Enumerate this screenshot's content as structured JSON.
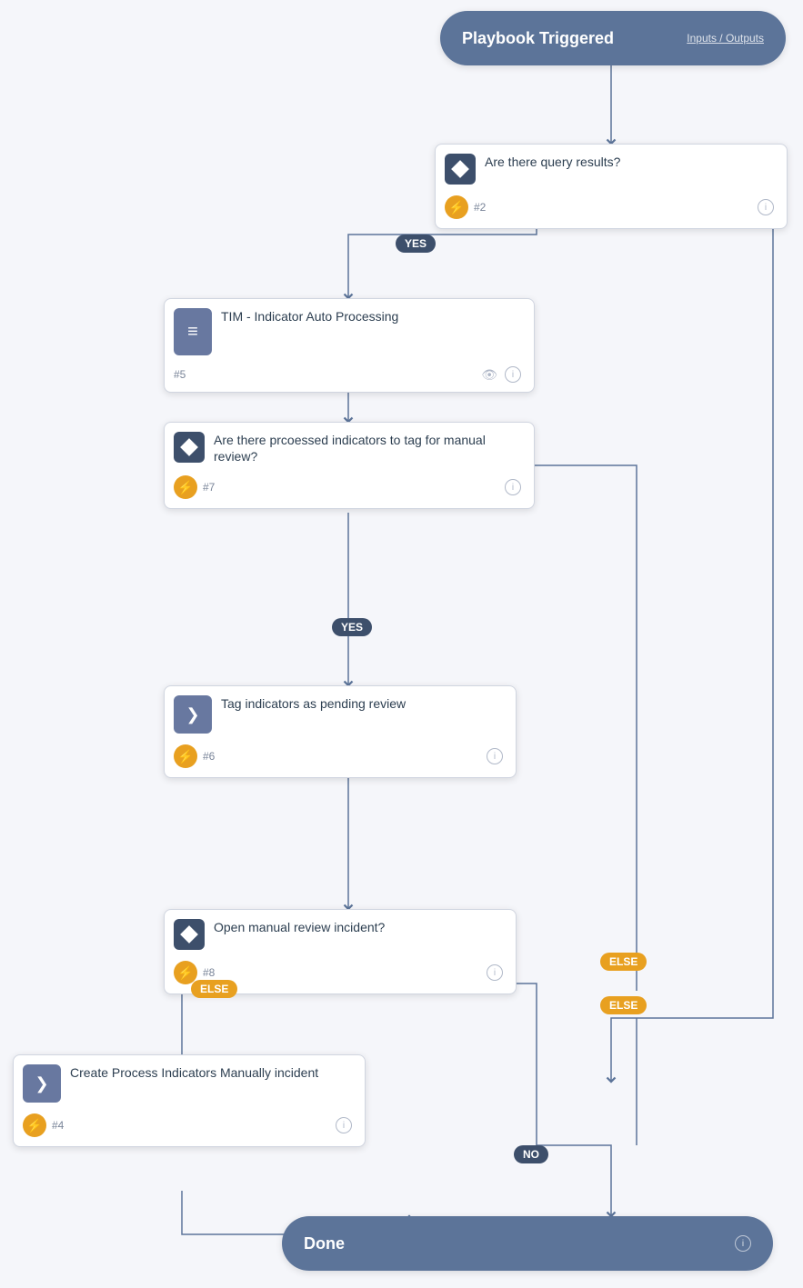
{
  "nodes": {
    "trigger": {
      "title": "Playbook Triggered",
      "link": "Inputs / Outputs"
    },
    "condition1": {
      "title": "Are there query results?",
      "num": "#2"
    },
    "subplaybook": {
      "title": "TIM - Indicator Auto Processing",
      "num": "#5"
    },
    "condition2": {
      "title": "Are there prcoessed indicators to tag for manual review?",
      "num": "#7"
    },
    "action1": {
      "title": "Tag indicators as pending review",
      "num": "#6"
    },
    "condition3": {
      "title": "Open manual review incident?",
      "num": "#8"
    },
    "action2": {
      "title": "Create Process Indicators Manually incident",
      "num": "#4"
    },
    "done": {
      "title": "Done"
    }
  },
  "badges": {
    "yes": "YES",
    "no": "NO",
    "else": "ELSE"
  },
  "icons": {
    "lightning": "⚡",
    "info": "i",
    "diamond": "",
    "chevron": "❯",
    "book": "≡"
  }
}
